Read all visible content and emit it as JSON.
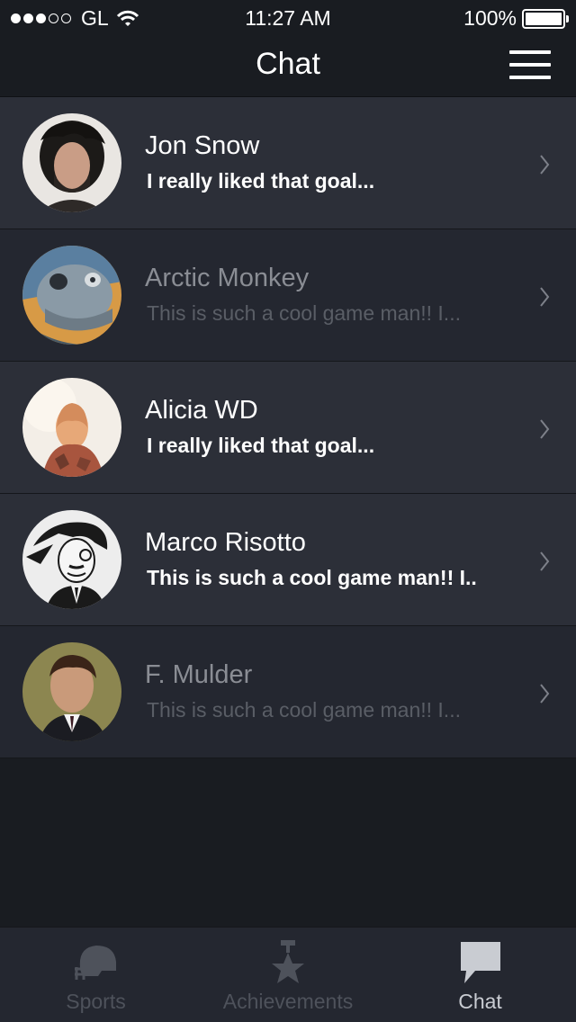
{
  "status_bar": {
    "carrier": "GL",
    "time": "11:27 AM",
    "battery": "100%",
    "signal_filled": 3,
    "signal_total": 5
  },
  "nav": {
    "title": "Chat",
    "menu_icon": "hamburger-menu-icon"
  },
  "chats": [
    {
      "name": "Jon Snow",
      "message": "I really liked that goal...",
      "unread": true,
      "avatar": "jon-snow-avatar"
    },
    {
      "name": "Arctic Monkey",
      "message": "This is such a cool game man!! I...",
      "unread": false,
      "avatar": "arctic-monkey-avatar"
    },
    {
      "name": "Alicia WD",
      "message": "I really liked that goal...",
      "unread": true,
      "avatar": "alicia-wd-avatar"
    },
    {
      "name": "Marco Risotto",
      "message": "This is such a cool game man!! I..",
      "unread": true,
      "avatar": "marco-risotto-avatar"
    },
    {
      "name": "F. Mulder",
      "message": "This is such a cool game man!! I...",
      "unread": false,
      "avatar": "f-mulder-avatar"
    }
  ],
  "tabs": [
    {
      "label": "Sports",
      "icon": "football-helmet-icon",
      "active": false
    },
    {
      "label": "Achievements",
      "icon": "star-trophy-icon",
      "active": false
    },
    {
      "label": "Chat",
      "icon": "chat-bubble-icon",
      "active": true
    }
  ],
  "colors": {
    "background": "#191c21",
    "row_unread": "#2c2f38",
    "row_read": "#242730",
    "tab_bar": "#242730",
    "tab_inactive": "#4e525b",
    "tab_active": "#c9ccd2"
  }
}
